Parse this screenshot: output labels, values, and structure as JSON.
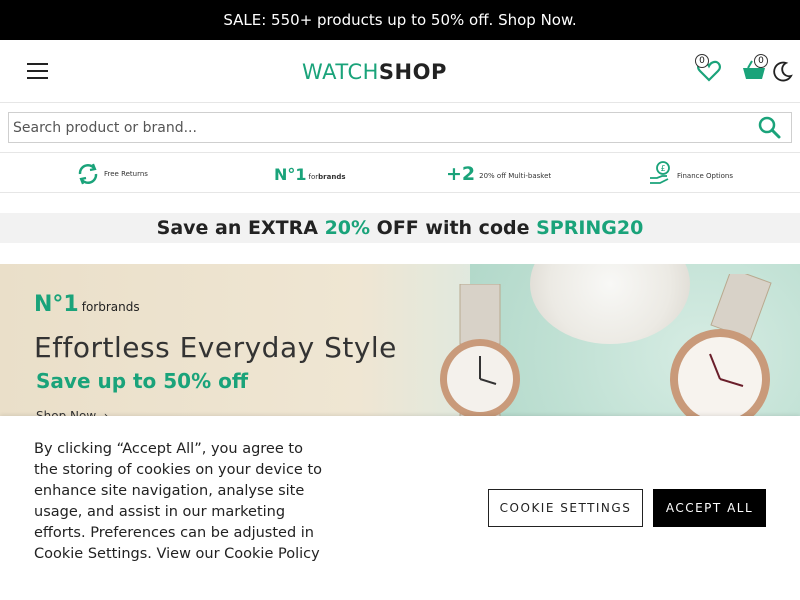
{
  "announcement": {
    "text": "SALE: 550+ products up to 50% off. Shop Now."
  },
  "header": {
    "logo_part1": "WATCH",
    "logo_part2": "SHOP",
    "wishlist_count": "0",
    "basket_count": "0",
    "icons": [
      "menu-icon",
      "heart-icon",
      "basket-icon",
      "moon-icon"
    ]
  },
  "search": {
    "placeholder": "Search product or brand..."
  },
  "usps": {
    "returns_label": "Free Returns",
    "no1_mark": "N°1",
    "no1_for": "for",
    "no1_brands": "brands",
    "plus_two": "+2",
    "multibasket_label": "20% off Multi-basket",
    "finance_label": "Finance Options"
  },
  "promo": {
    "prefix": "Save an EXTRA ",
    "highlight": "20%",
    "middle": " OFF with code ",
    "code": "SPRING20"
  },
  "hero": {
    "badge_mark": "N°1",
    "badge_text": "forbrands",
    "title": "Effortless Everyday Style",
    "subtitle": "Save up to 50% off",
    "cta": "Shop Now  ›"
  },
  "cookie": {
    "message": "By clicking “Accept All”, you agree to the storing of cookies on your device to enhance site navigation, analyse site usage, and assist in our marketing efforts. Preferences can be adjusted in Cookie Settings. View our Cookie Policy",
    "settings_label": "COOKIE SETTINGS",
    "accept_label": "ACCEPT ALL"
  },
  "colors": {
    "brand_green": "#1aa37a",
    "dark": "#000000"
  }
}
